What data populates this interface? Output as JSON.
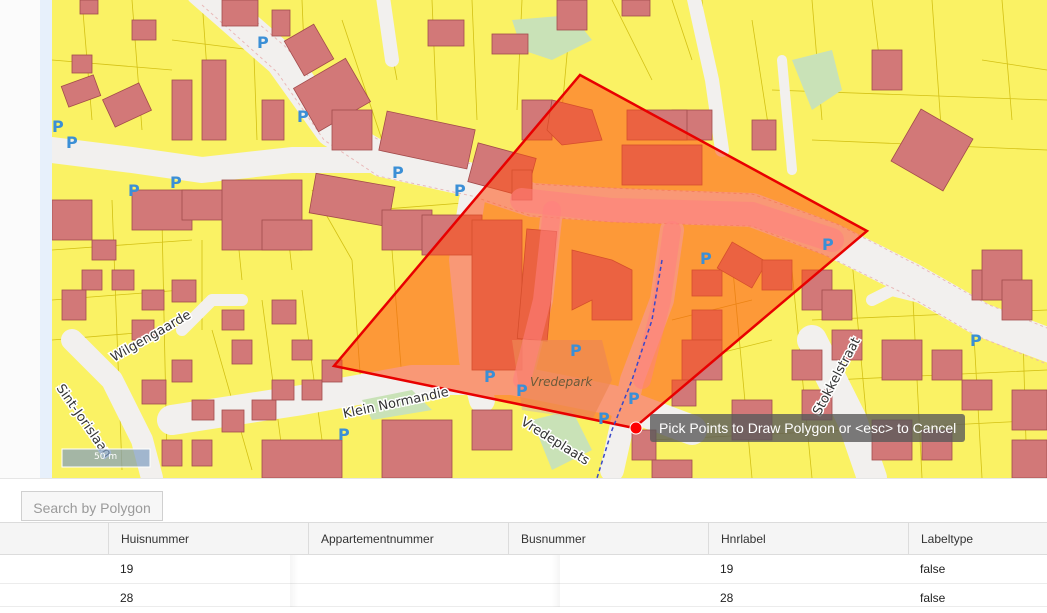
{
  "map": {
    "street_labels": [
      "Wilgengaarde",
      "Sint-Jorislaan",
      "Klein Normandie",
      "Vredeplaats",
      "Stokkelstraat",
      "Vredepark"
    ],
    "parking_symbol": "P",
    "scale_label": "50 m",
    "tooltip": "Pick Points to Draw Polygon or <esc> to Cancel",
    "colors": {
      "parcel": "#faf264",
      "building": "#d27878",
      "road": "#f2f0ee",
      "polygon_fill": "#ff5014",
      "polygon_stroke": "#e80000",
      "park": "#c9e2b7",
      "parking_text": "#3b8fd6"
    }
  },
  "toolbar": {
    "search_button": "Search by Polygon"
  },
  "grid": {
    "columns": [
      "Huisnummer",
      "Appartementnummer",
      "Busnummer",
      "Hnrlabel",
      "Labeltype"
    ],
    "rows": [
      {
        "huisnummer": "19",
        "appartementnummer": "",
        "busnummer": "",
        "hnrlabel": "19",
        "labeltype": "false"
      },
      {
        "huisnummer": "28",
        "appartementnummer": "",
        "busnummer": "",
        "hnrlabel": "28",
        "labeltype": "false"
      }
    ]
  }
}
